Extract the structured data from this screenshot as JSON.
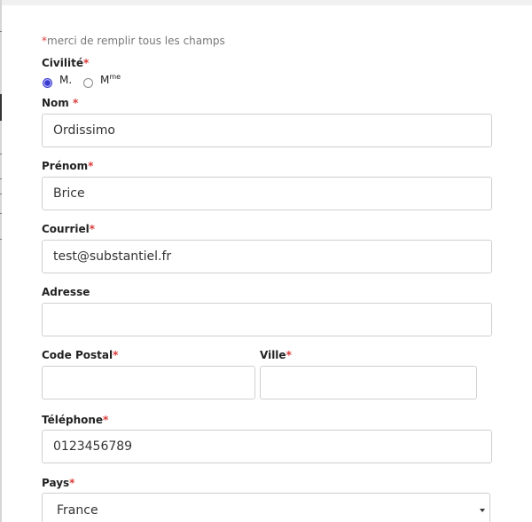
{
  "form": {
    "required_note": {
      "star": "*",
      "text": "merci de remplir tous les champs"
    },
    "civilite": {
      "label": "Civilité",
      "required": "*",
      "options": [
        {
          "label": "M.",
          "selected": true
        },
        {
          "label": "M",
          "superscript": "me",
          "selected": false
        }
      ]
    },
    "nom": {
      "label": "Nom",
      "required": "*",
      "value": "Ordissimo"
    },
    "prenom": {
      "label": "Prénom",
      "required": "*",
      "value": "Brice"
    },
    "courriel": {
      "label": "Courriel",
      "required": "*",
      "value": "test@substantiel.fr"
    },
    "adresse": {
      "label": "Adresse",
      "value": ""
    },
    "code_postal": {
      "label": "Code Postal",
      "required": "*",
      "value": ""
    },
    "ville": {
      "label": "Ville",
      "required": "*",
      "value": ""
    },
    "telephone": {
      "label": "Téléphone",
      "required": "*",
      "value": "0123456789"
    },
    "pays": {
      "label": "Pays",
      "required": "*",
      "value": "France"
    }
  },
  "colors": {
    "required_star": "#d93b3b",
    "radio_selected": "#3a3ad0",
    "field_border": "#cfcfcf"
  }
}
